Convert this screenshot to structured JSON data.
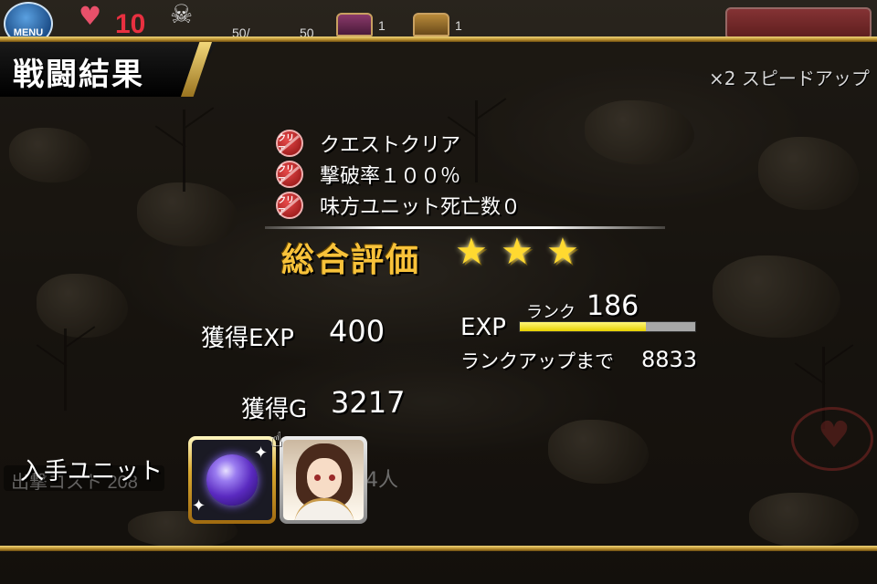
{
  "hud": {
    "menu_label": "MENU",
    "life_value": "10",
    "kill_text": "50/",
    "kill_total": "50",
    "chest1_count": "1",
    "chest2_count": "1"
  },
  "header": {
    "title": "戦闘結果",
    "speed_label": "×2 スピードアップ"
  },
  "conditions": [
    {
      "badge": "クリア",
      "text": "クエストクリア"
    },
    {
      "badge": "クリア",
      "text": "撃破率１００％"
    },
    {
      "badge": "クリア",
      "text": "味方ユニット死亡数０"
    }
  ],
  "rating": {
    "label": "総合評価",
    "stars": 3
  },
  "rewards": {
    "exp_label": "獲得EXP",
    "exp_value": "400",
    "gold_label": "獲得G",
    "gold_value": "3217"
  },
  "rank": {
    "exp_label": "EXP",
    "rank_label": "ランク",
    "rank_value": "186",
    "exp_progress": 0.72,
    "rankup_label": "ランクアップまで",
    "rankup_value": "8833"
  },
  "units": {
    "label": "入手ユニット",
    "items": [
      {
        "name": "purple-orb"
      },
      {
        "name": "brown-haired-girl"
      }
    ]
  },
  "background": {
    "deploy_text": "出撃コスト 208",
    "count_text": "4人"
  },
  "colors": {
    "gold": "#f8c23a",
    "star": "#ffd930",
    "exp_fill": "#e6d000",
    "clear_badge": "#d02a2a"
  }
}
